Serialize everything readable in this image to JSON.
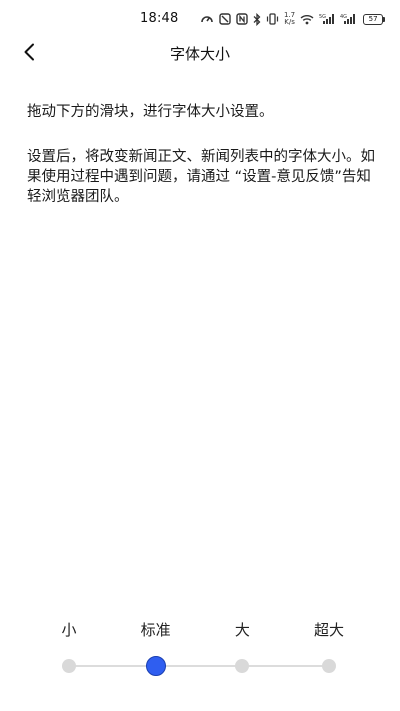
{
  "status_bar": {
    "time": "18:48",
    "net_speed_value": "1.7",
    "net_speed_unit": "K/s",
    "battery_level": "57",
    "icons": [
      "nfc-icon",
      "no-sim-icon",
      "nfc-n-icon",
      "bluetooth-icon",
      "vibrate-icon",
      "wifi-icon",
      "signal-5g-icon",
      "signal-4g-icon",
      "battery-icon"
    ]
  },
  "header": {
    "title": "字体大小",
    "back_icon": "chevron-left-icon"
  },
  "content": {
    "instruction": "拖动下方的滑块，进行字体大小设置。",
    "explanation": "设置后，将改变新闻正文、新闻列表中的字体大小。如果使用过程中遇到问题，请通过 “设置-意见反馈”告知轻浏览器团队。"
  },
  "font_size_slider": {
    "options": [
      "小",
      "标准",
      "大",
      "超大"
    ],
    "selected_index": 1,
    "selected_label": "标准"
  },
  "colors": {
    "accent": "#2f5ef0",
    "track": "#dcdcdc",
    "dot": "#d9d9d9",
    "text": "#1a1a1a"
  }
}
